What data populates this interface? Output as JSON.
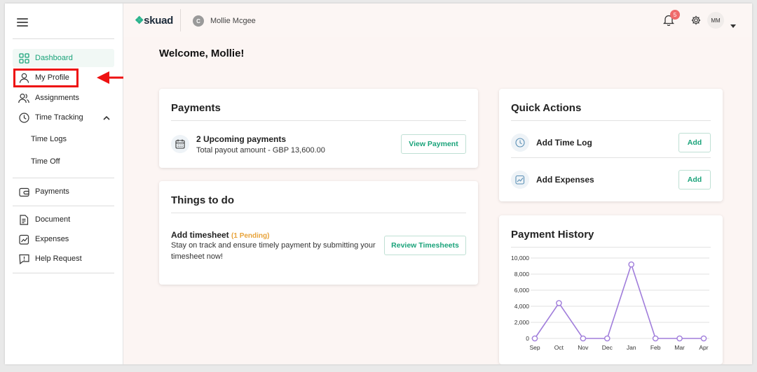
{
  "sidebar": {
    "items": [
      {
        "label": "Dashboard"
      },
      {
        "label": "My Profile"
      },
      {
        "label": "Assignments"
      },
      {
        "label": "Time Tracking"
      },
      {
        "label": "Time Logs"
      },
      {
        "label": "Time Off"
      },
      {
        "label": "Payments"
      },
      {
        "label": "Document"
      },
      {
        "label": "Expenses"
      },
      {
        "label": "Help Request"
      }
    ]
  },
  "header": {
    "logo": "skuad",
    "user_initial": "C",
    "user_name": "Mollie Mcgee",
    "notification_count": "5",
    "avatar_initials": "MM"
  },
  "main": {
    "welcome": "Welcome, Mollie!",
    "payments": {
      "title": "Payments",
      "upcoming": "2 Upcoming payments",
      "payout": "Total payout amount - GBP 13,600.00",
      "button": "View Payment"
    },
    "things_to_do": {
      "title": "Things to do",
      "task": "Add timesheet",
      "pending": "(1 Pending)",
      "desc_line1": "Stay on track and ensure timely payment by submitting your",
      "desc_line2": "timesheet now!",
      "button": "Review Timesheets"
    },
    "quick_actions": {
      "title": "Quick Actions",
      "items": [
        {
          "label": "Add Time Log",
          "button": "Add"
        },
        {
          "label": "Add Expenses",
          "button": "Add"
        }
      ]
    },
    "payment_history": {
      "title": "Payment History"
    }
  },
  "chart_data": {
    "type": "line",
    "categories": [
      "Sep",
      "Oct",
      "Nov",
      "Dec",
      "Jan",
      "Feb",
      "Mar",
      "Apr"
    ],
    "series": [
      {
        "values": [
          0,
          4400,
          0,
          0,
          9200,
          0,
          0,
          0
        ]
      }
    ],
    "ylim": [
      0,
      10000
    ],
    "yticks": [
      "10,000",
      "8,000",
      "6,000",
      "4,000",
      "2,000",
      "0"
    ],
    "grid": true,
    "color": "#a07ddb"
  },
  "colors": {
    "accent": "#1aa37a",
    "highlight": "#e11111",
    "pending": "#e8a33a"
  }
}
